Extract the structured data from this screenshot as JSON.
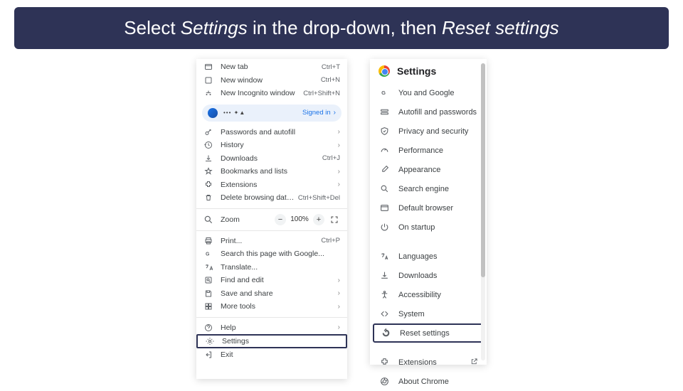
{
  "banner": {
    "prefix": "Select ",
    "em1": "Settings",
    "mid": " in the drop-down, then ",
    "em2": "Reset settings"
  },
  "menu": {
    "new_tab": {
      "label": "New tab",
      "shortcut": "Ctrl+T"
    },
    "new_window": {
      "label": "New window",
      "shortcut": "Ctrl+N"
    },
    "new_incognito": {
      "label": "New Incognito window",
      "shortcut": "Ctrl+Shift+N"
    },
    "account": {
      "masked": "••• ✦▲",
      "status": "Signed in"
    },
    "passwords": {
      "label": "Passwords and autofill"
    },
    "history": {
      "label": "History"
    },
    "downloads": {
      "label": "Downloads",
      "shortcut": "Ctrl+J"
    },
    "bookmarks": {
      "label": "Bookmarks and lists"
    },
    "extensions": {
      "label": "Extensions"
    },
    "delete_data": {
      "label": "Delete browsing data...",
      "shortcut": "Ctrl+Shift+Del"
    },
    "zoom": {
      "label": "Zoom",
      "value": "100%"
    },
    "print": {
      "label": "Print...",
      "shortcut": "Ctrl+P"
    },
    "search_google": {
      "label": "Search this page with Google..."
    },
    "translate": {
      "label": "Translate..."
    },
    "find_edit": {
      "label": "Find and edit"
    },
    "save_share": {
      "label": "Save and share"
    },
    "more_tools": {
      "label": "More tools"
    },
    "help": {
      "label": "Help"
    },
    "settings": {
      "label": "Settings"
    },
    "exit": {
      "label": "Exit"
    }
  },
  "settingsPanel": {
    "title": "Settings",
    "you_google": "You and Google",
    "autofill_pw": "Autofill and passwords",
    "privacy": "Privacy and security",
    "performance": "Performance",
    "appearance": "Appearance",
    "search_engine": "Search engine",
    "default_browser": "Default browser",
    "on_startup": "On startup",
    "languages": "Languages",
    "downloads": "Downloads",
    "accessibility": "Accessibility",
    "system": "System",
    "reset": "Reset settings",
    "extensions": "Extensions",
    "about": "About Chrome"
  }
}
